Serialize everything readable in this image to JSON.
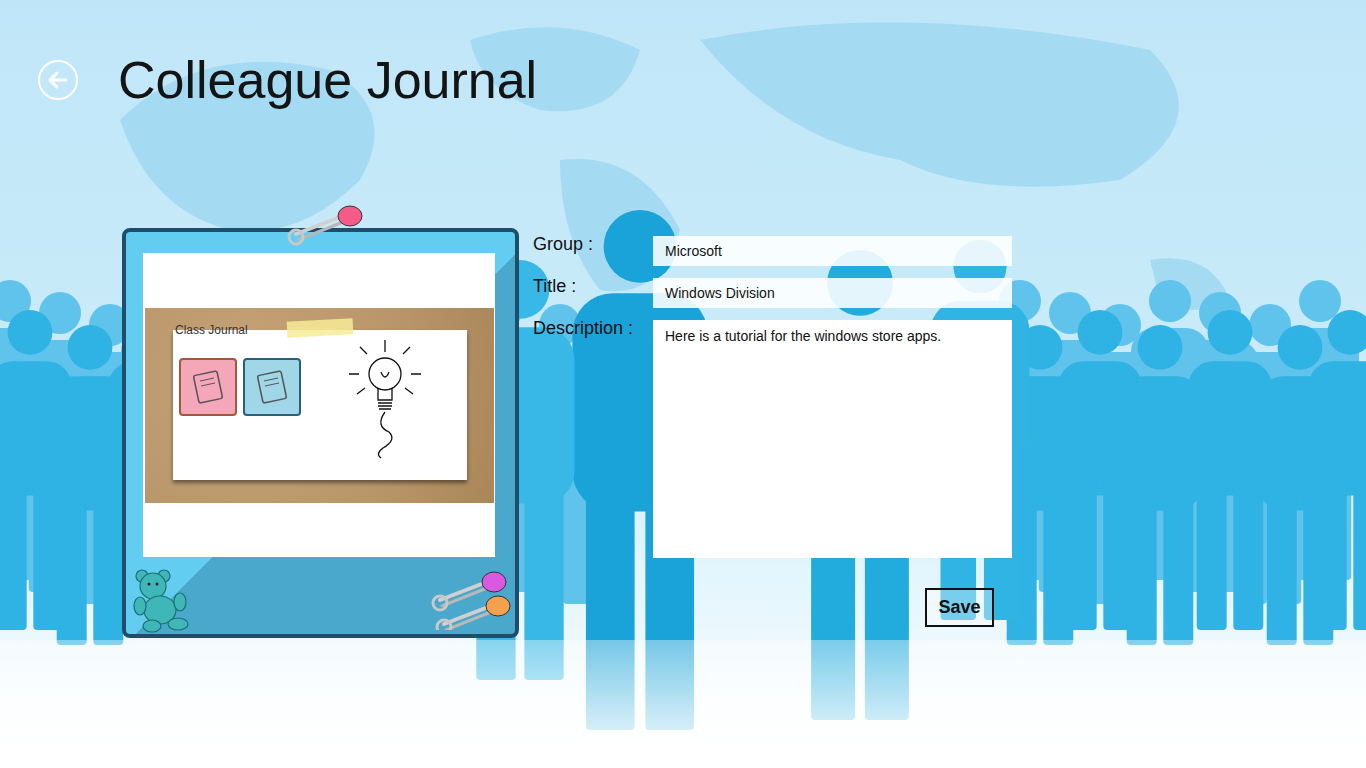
{
  "app": {
    "title": "Colleague Journal"
  },
  "preview": {
    "board_title": "Class Journal",
    "notebooks": [
      {
        "color": "#f4a7b9"
      },
      {
        "color": "#9fd6e8"
      }
    ]
  },
  "form": {
    "fields": [
      {
        "label": "Group :",
        "value": "Microsoft",
        "kind": "line"
      },
      {
        "label": "Title :",
        "value": "Windows Division",
        "kind": "line"
      },
      {
        "label": "Description :",
        "value": "Here is a tutorial for the windows store apps.",
        "kind": "area"
      }
    ],
    "buttons": [
      "Save"
    ]
  }
}
